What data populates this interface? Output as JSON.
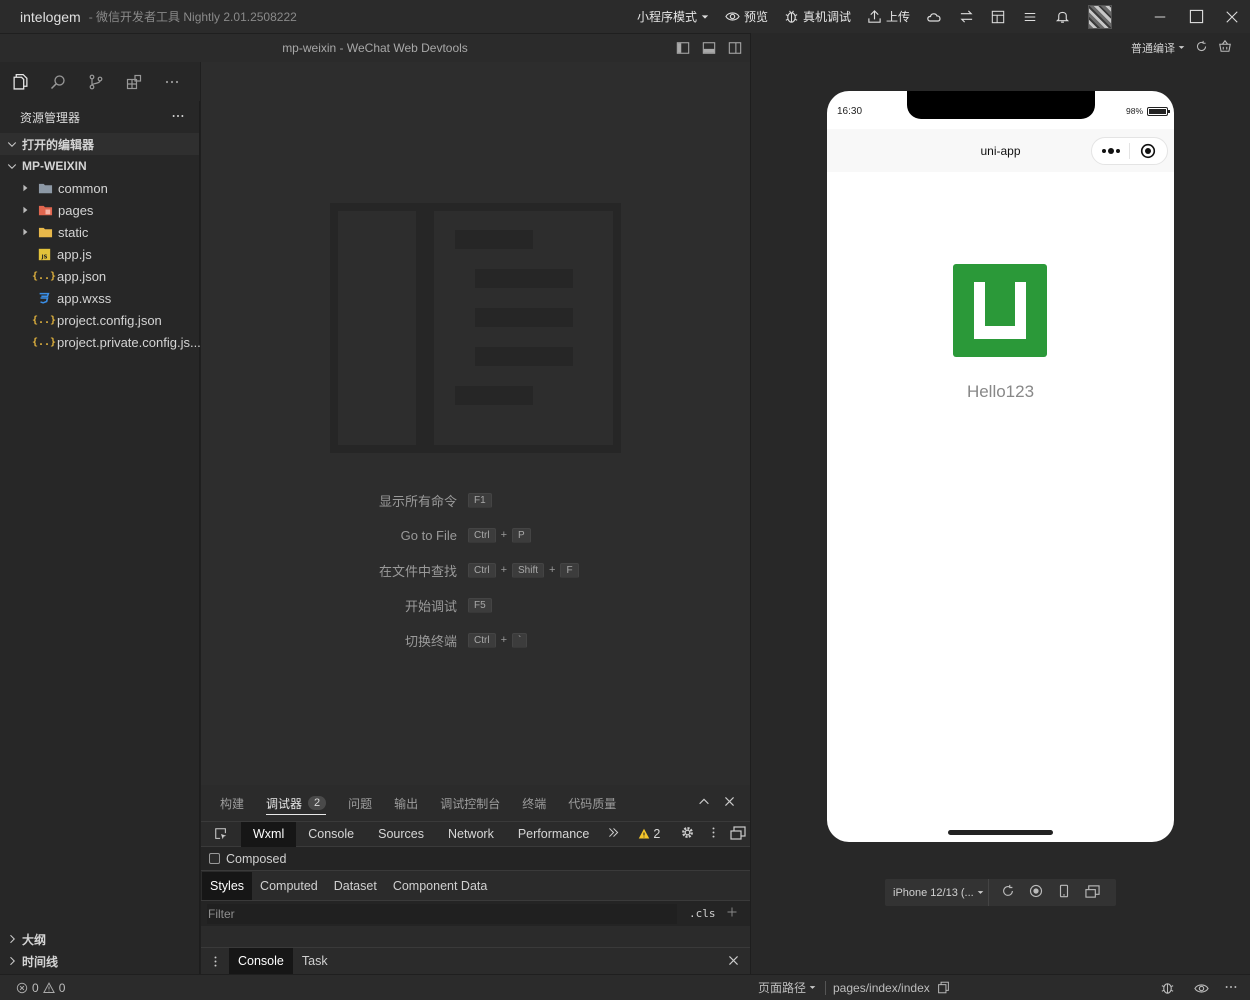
{
  "titlebar": {
    "app_name": "intelogem",
    "subtitle": "- 微信开发者工具 Nightly 2.01.2508222",
    "mode": "小程序模式",
    "preview": "预览",
    "remote_debug": "真机调试",
    "upload": "上传"
  },
  "editor": {
    "title": "mp-weixin - WeChat Web Devtools",
    "shortcuts": [
      {
        "label": "显示所有命令",
        "keys": [
          "F1"
        ]
      },
      {
        "label": "Go to File",
        "keys": [
          "Ctrl",
          "P"
        ]
      },
      {
        "label": "在文件中查找",
        "keys": [
          "Ctrl",
          "Shift",
          "F"
        ]
      },
      {
        "label": "开始调试",
        "keys": [
          "F5"
        ]
      },
      {
        "label": "切换终端",
        "keys": [
          "Ctrl",
          "`"
        ]
      }
    ]
  },
  "explorer": {
    "title": "资源管理器",
    "open_editors": "打开的编辑器",
    "project": "MP-WEIXIN",
    "items": [
      {
        "name": "common",
        "type": "folder"
      },
      {
        "name": "pages",
        "type": "folder"
      },
      {
        "name": "static",
        "type": "folder"
      },
      {
        "name": "app.js",
        "type": "js"
      },
      {
        "name": "app.json",
        "type": "json"
      },
      {
        "name": "app.wxss",
        "type": "css"
      },
      {
        "name": "project.config.json",
        "type": "json"
      },
      {
        "name": "project.private.config.js...",
        "type": "json"
      }
    ],
    "outline": "大纲",
    "timeline": "时间线"
  },
  "panel": {
    "tabs": [
      "构建",
      "调试器",
      "问题",
      "输出",
      "调试控制台",
      "终端",
      "代码质量"
    ],
    "debugger_count": "2",
    "devtools_tabs": [
      "Wxml",
      "Console",
      "Sources",
      "Network",
      "Performance"
    ],
    "warning_count": "2",
    "composed": "Composed",
    "style_tabs": [
      "Styles",
      "Computed",
      "Dataset",
      "Component Data"
    ],
    "filter_placeholder": "Filter",
    "cls": ".cls",
    "console_tabs": [
      "Console",
      "Task"
    ]
  },
  "simulator": {
    "compile_mode": "普通编译",
    "time": "16:30",
    "battery": "98%",
    "battery_level": 0.98,
    "nav_title": "uni-app",
    "hello_text": "Hello123",
    "device": "iPhone 12/13 (...",
    "logo_color": "#2b9939"
  },
  "statusbar": {
    "errors": "0",
    "warnings": "0",
    "page_path_label": "页面路径",
    "page_path": "pages/index/index"
  }
}
